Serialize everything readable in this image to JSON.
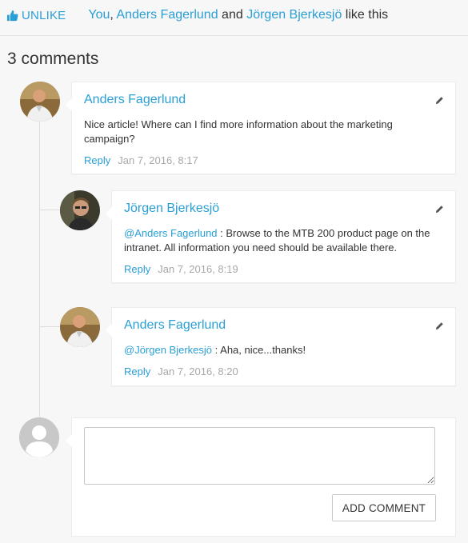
{
  "like_bar": {
    "unlike_label": "UNLIKE",
    "likers": [
      {
        "text": "You",
        "link": true
      },
      {
        "text": ", ",
        "link": false
      },
      {
        "text": "Anders Fagerlund",
        "link": true
      },
      {
        "text": " and ",
        "link": false
      },
      {
        "text": "Jörgen Bjerkesjö",
        "link": true
      },
      {
        "text": " like this",
        "link": false
      }
    ]
  },
  "comments_title": "3 comments",
  "comments": [
    {
      "author": "Anders Fagerlund",
      "mention": "",
      "text": "Nice article! Where can I find more information about the marketing campaign?",
      "reply_label": "Reply",
      "timestamp": "Jan 7, 2016, 8:17"
    },
    {
      "author": "Jörgen Bjerkesjö",
      "mention": "@Anders Fagerlund",
      "text": " : Browse to the MTB 200 product page on the intranet. All information you need should be available there.",
      "reply_label": "Reply",
      "timestamp": "Jan 7, 2016, 8:19"
    },
    {
      "author": "Anders Fagerlund",
      "mention": "@Jörgen Bjerkesjö",
      "text": " : Aha, nice...thanks!",
      "reply_label": "Reply",
      "timestamp": "Jan 7, 2016, 8:20"
    }
  ],
  "new_comment": {
    "placeholder": "",
    "button_label": "ADD COMMENT"
  },
  "colors": {
    "link": "#2a9fd6",
    "timestamp": "#a8a8a8",
    "background": "#f7f7f7"
  },
  "icons": [
    "thumbs-up-icon",
    "pencil-icon",
    "user-avatar-icon"
  ]
}
